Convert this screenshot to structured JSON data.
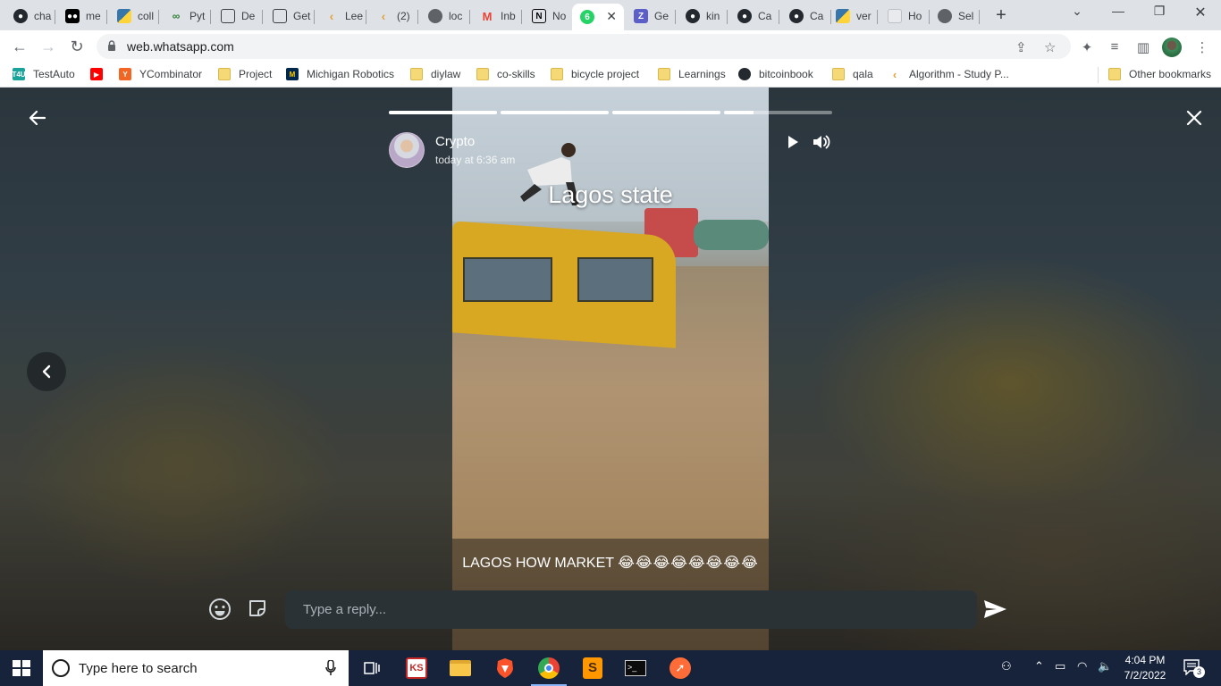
{
  "browser": {
    "tabs": [
      {
        "label": "cha",
        "icon": "github-icon"
      },
      {
        "label": "me",
        "icon": "medium-icon"
      },
      {
        "label": "coll",
        "icon": "python-icon"
      },
      {
        "label": "Pyt",
        "icon": "python-snake-icon"
      },
      {
        "label": "De",
        "icon": "document-icon"
      },
      {
        "label": "Get",
        "icon": "document-icon"
      },
      {
        "label": "Lee",
        "icon": "leetcode-icon"
      },
      {
        "label": "(2)",
        "icon": "leetcode-icon"
      },
      {
        "label": "loc",
        "icon": "globe-icon"
      },
      {
        "label": "Inb",
        "icon": "gmail-icon"
      },
      {
        "label": "No",
        "icon": "notion-icon"
      },
      {
        "label": "",
        "icon": "whatsapp-icon",
        "badge": "6",
        "active": true
      },
      {
        "label": "Ge",
        "icon": "z-icon"
      },
      {
        "label": "kin",
        "icon": "github-icon"
      },
      {
        "label": "Ca",
        "icon": "github-icon"
      },
      {
        "label": "Ca",
        "icon": "github-icon"
      },
      {
        "label": "ver",
        "icon": "python-icon"
      },
      {
        "label": "Ho",
        "icon": "messenger-icon"
      },
      {
        "label": "Sel",
        "icon": "globe-icon"
      }
    ],
    "address": {
      "url": "web.whatsapp.com"
    },
    "bookmarks": [
      {
        "label": "TestAuto",
        "icon": "t4u-icon"
      },
      {
        "label": "",
        "icon": "youtube-icon"
      },
      {
        "label": "YCombinator",
        "icon": "ycombinator-icon"
      },
      {
        "label": "Project",
        "icon": "folder-icon"
      },
      {
        "label": "Michigan Robotics",
        "icon": "michigan-icon"
      },
      {
        "label": "diylaw",
        "icon": "folder-icon"
      },
      {
        "label": "co-skills",
        "icon": "folder-icon"
      },
      {
        "label": "bicycle project",
        "icon": "folder-icon"
      },
      {
        "label": "Learnings",
        "icon": "folder-icon"
      },
      {
        "label": "bitcoinbook",
        "icon": "github-icon"
      },
      {
        "label": "qala",
        "icon": "folder-icon"
      },
      {
        "label": "Algorithm - Study P...",
        "icon": "leetcode-icon"
      }
    ],
    "other_bookmarks": "Other bookmarks"
  },
  "status": {
    "contact_name": "Crypto",
    "timestamp": "today at 6:36 am",
    "video_overlay_text": "Lagos state",
    "caption": "LAGOS HOW MARKET",
    "caption_emojis": "😂😂😂😂😂😂😂😂",
    "progress": [
      1.0,
      1.0,
      1.0,
      0.27
    ],
    "reply_placeholder": "Type a reply..."
  },
  "taskbar": {
    "search_placeholder": "Type here to search",
    "time": "4:04 PM",
    "date": "7/2/2022",
    "notification_count": "3",
    "apps": [
      "task-view-icon",
      "app-icon",
      "file-explorer-icon",
      "brave-icon",
      "chrome-icon",
      "sublime-icon",
      "terminal-icon",
      "postman-icon"
    ]
  },
  "colors": {
    "whatsapp_green": "#25d366",
    "reply_box": "#2a3236",
    "taskbar": "#16233b"
  }
}
